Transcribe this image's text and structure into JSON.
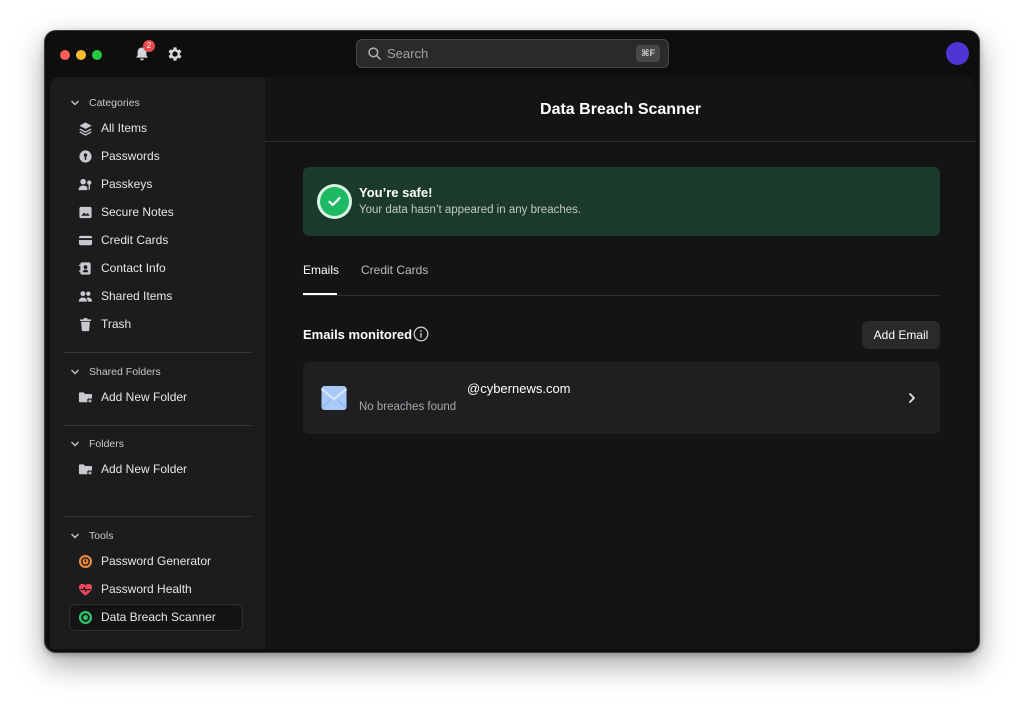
{
  "titlebar": {
    "notification_count": "2",
    "search_placeholder": "Search",
    "search_shortcut": "⌘F"
  },
  "sidebar": {
    "categories_header": "Categories",
    "categories": [
      {
        "label": "All Items",
        "icon": "layers-icon"
      },
      {
        "label": "Passwords",
        "icon": "key-icon"
      },
      {
        "label": "Passkeys",
        "icon": "passkey-icon"
      },
      {
        "label": "Secure Notes",
        "icon": "note-icon"
      },
      {
        "label": "Credit Cards",
        "icon": "credit-card-icon"
      },
      {
        "label": "Contact Info",
        "icon": "contact-icon"
      },
      {
        "label": "Shared Items",
        "icon": "users-icon"
      },
      {
        "label": "Trash",
        "icon": "trash-icon"
      }
    ],
    "shared_folders_header": "Shared Folders",
    "shared_folders_add": "Add New Folder",
    "folders_header": "Folders",
    "folders_add": "Add New Folder",
    "tools_header": "Tools",
    "tools": [
      {
        "label": "Password Generator",
        "icon": "password-generator-icon"
      },
      {
        "label": "Password Health",
        "icon": "heart-pulse-icon"
      },
      {
        "label": "Data Breach Scanner",
        "icon": "breach-scanner-icon",
        "active": true
      }
    ]
  },
  "main": {
    "title": "Data Breach Scanner",
    "banner": {
      "title": "You’re safe!",
      "subtitle": "Your data hasn’t appeared in any breaches."
    },
    "tabs": [
      {
        "label": "Emails",
        "active": true
      },
      {
        "label": "Credit Cards",
        "active": false
      }
    ],
    "emails_heading": "Emails monitored",
    "add_email_label": "Add Email",
    "emails": [
      {
        "address": "@cybernews.com",
        "status": "No breaches found"
      }
    ]
  },
  "colors": {
    "accent_green": "#1fb863",
    "banner_bg": "#1b3a2b",
    "avatar": "#4f35d6"
  }
}
